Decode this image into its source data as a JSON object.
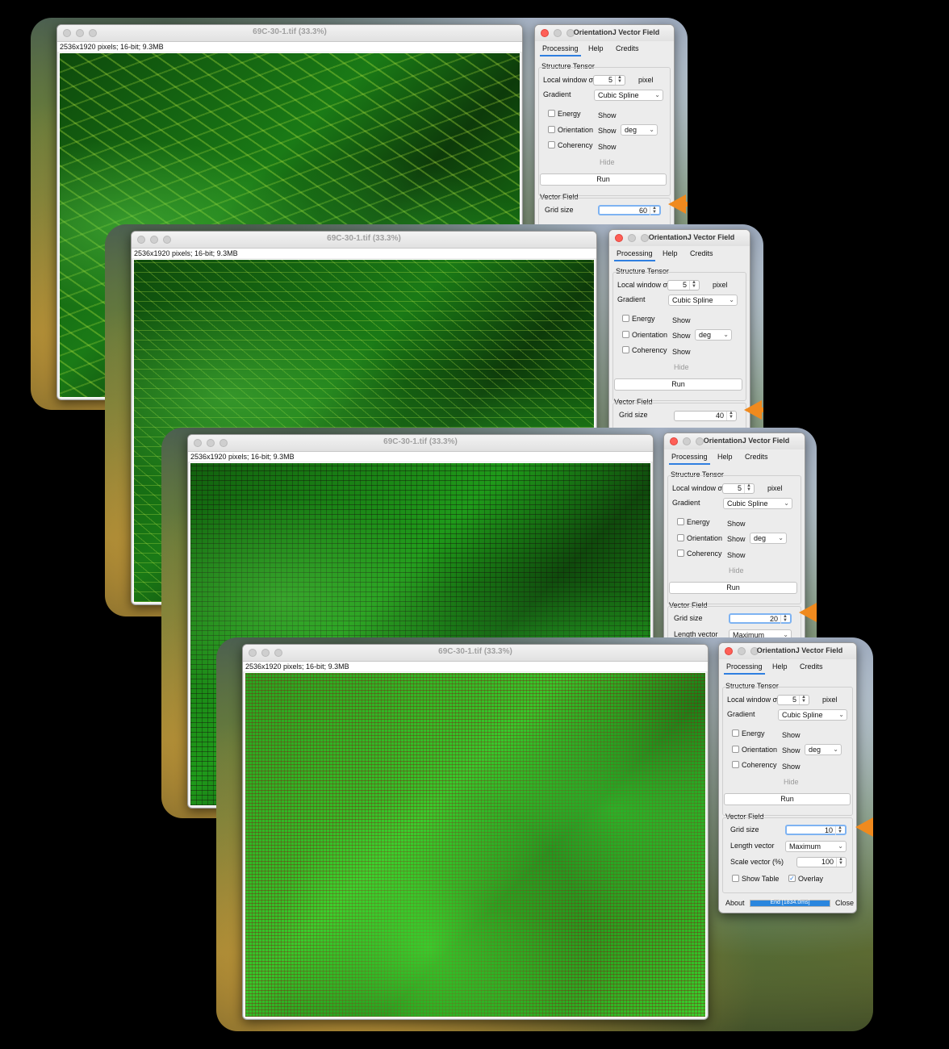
{
  "window_title": "69C-30-1.tif (33.3%)",
  "image_info": "2536x1920 pixels; 16-bit; 9.3MB",
  "panel": {
    "title": "OrientationJ Vector Field",
    "tabs": [
      "Processing",
      "Help",
      "Credits"
    ],
    "structure_tensor": "Structure Tensor",
    "local_window_label": "Local window σ",
    "local_window_value": "5",
    "local_window_unit": "pixel",
    "gradient_label": "Gradient",
    "gradient_value": "Cubic Spline",
    "energy": "Energy",
    "orientation": "Orientation",
    "coherency": "Coherency",
    "show": "Show",
    "deg": "deg",
    "hide": "Hide",
    "run": "Run",
    "vector_field": "Vector Field",
    "grid_size_label": "Grid size",
    "length_vector_label": "Length vector",
    "length_vector_value": "Maximum",
    "scale_vector_label": "Scale vector (%)",
    "scale_vector_value": "100",
    "show_table": "Show Table",
    "overlay": "Overlay",
    "overlay_checked": true,
    "about": "About",
    "progress_text": "End [1834.0ms]",
    "progress_fraction": 1.0,
    "close": "Close"
  },
  "layers": [
    {
      "grid_size": "60"
    },
    {
      "grid_size": "40"
    },
    {
      "grid_size": "20"
    },
    {
      "grid_size": "10"
    }
  ],
  "colors": {
    "arrow": "#f08a1e",
    "image_green": "#1fd61f",
    "accent": "#2f7fe0"
  }
}
